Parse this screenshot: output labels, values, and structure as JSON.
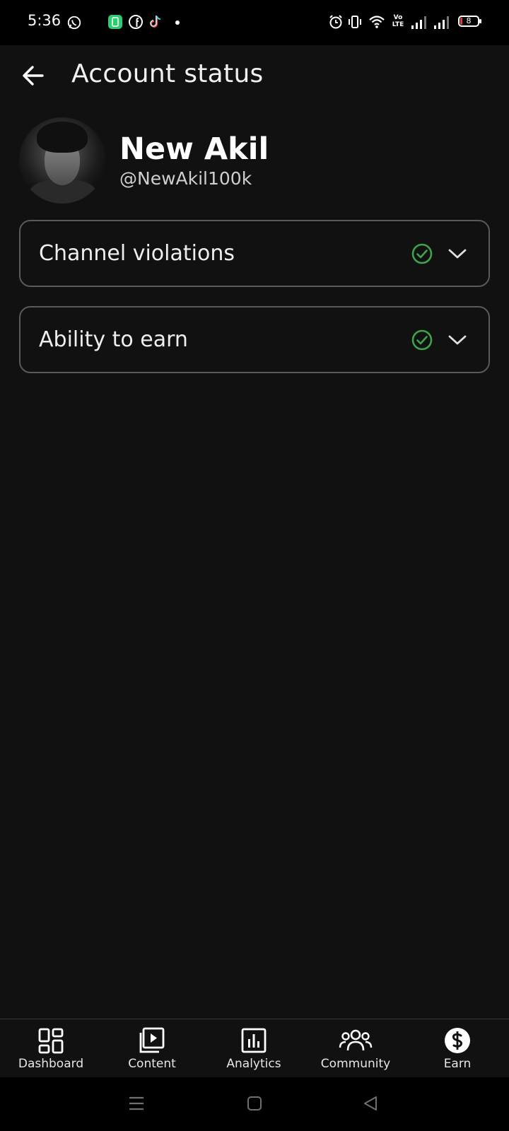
{
  "status_bar": {
    "time": "5:36",
    "battery": "8",
    "network_label": "Vo LTE",
    "icons": [
      "whatsapp-icon",
      "app-icon",
      "facebook-icon",
      "tiktok-icon",
      "dot-icon",
      "alarm-icon",
      "vibrate-icon",
      "wifi-icon",
      "volte-icon",
      "signal-icon",
      "signal-icon",
      "battery-icon"
    ]
  },
  "header": {
    "title": "Account status",
    "back_icon": "arrow-left-icon"
  },
  "profile": {
    "name": "New Akil",
    "handle": "@NewAkil100k"
  },
  "cards": [
    {
      "label": "Channel violations",
      "status_icon": "check-circle-icon",
      "expand_icon": "chevron-down-icon"
    },
    {
      "label": "Ability to earn",
      "status_icon": "check-circle-icon",
      "expand_icon": "chevron-down-icon"
    }
  ],
  "bottom_nav": [
    {
      "label": "Dashboard",
      "icon": "dashboard-icon",
      "active": false
    },
    {
      "label": "Content",
      "icon": "content-icon",
      "active": false
    },
    {
      "label": "Analytics",
      "icon": "analytics-icon",
      "active": false
    },
    {
      "label": "Community",
      "icon": "community-icon",
      "active": false
    },
    {
      "label": "Earn",
      "icon": "dollar-icon",
      "active": true
    }
  ],
  "colors": {
    "background": "#111111",
    "status_bar": "#000000",
    "check_green": "#3ea34b",
    "card_border": "#5a5a5a",
    "text": "#f1f1f1"
  }
}
